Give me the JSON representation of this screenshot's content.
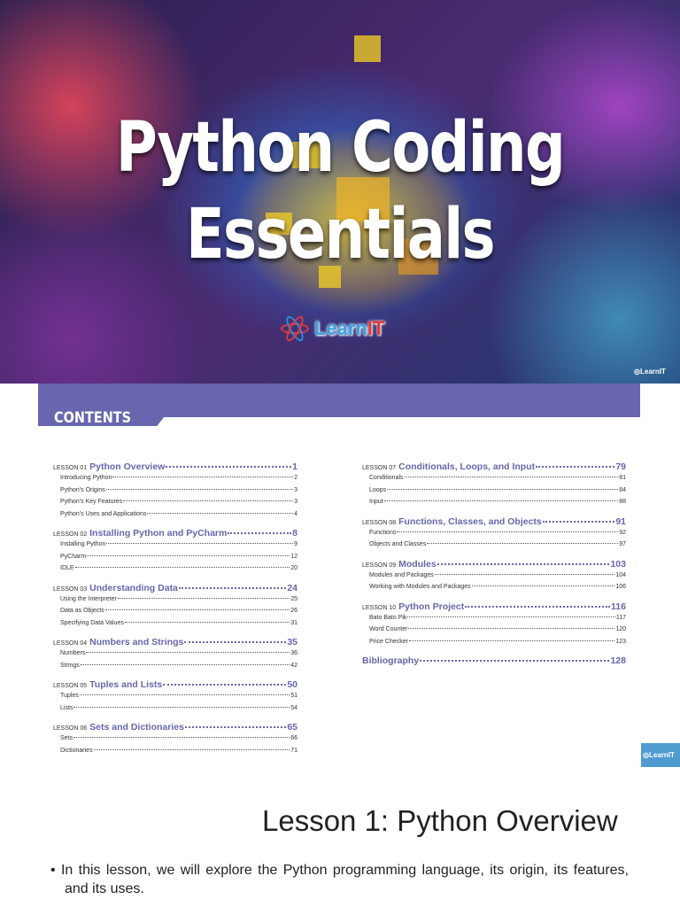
{
  "cover": {
    "title_line1": "Python Coding",
    "title_line2": "Essentials",
    "logo_text": "LearnIT"
  },
  "contents_label": "CONTENTS",
  "lesson_prefix": "LESSON",
  "toc_left": [
    {
      "num": "01",
      "title": "Python Overview",
      "page": "1",
      "subs": [
        [
          "Introducing Python",
          "2"
        ],
        [
          "Python's Origins",
          "3"
        ],
        [
          "Python's Key Features",
          "3"
        ],
        [
          "Python's Uses and Applications",
          "4"
        ]
      ]
    },
    {
      "num": "02",
      "title": "Installing Python and PyCharm",
      "page": "8",
      "subs": [
        [
          "Installing Python",
          "9"
        ],
        [
          "PyCharm",
          "12"
        ],
        [
          "IDLE",
          "20"
        ]
      ]
    },
    {
      "num": "03",
      "title": "Understanding Data",
      "page": "24",
      "subs": [
        [
          "Using the Interpreter",
          "25"
        ],
        [
          "Data as Objects",
          "26"
        ],
        [
          "Specifying Data Values",
          "31"
        ]
      ]
    },
    {
      "num": "04",
      "title": "Numbers and Strings",
      "page": "35",
      "subs": [
        [
          "Numbers",
          "36"
        ],
        [
          "Strings",
          "42"
        ]
      ]
    },
    {
      "num": "05",
      "title": "Tuples and Lists",
      "page": "50",
      "subs": [
        [
          "Tuples",
          "51"
        ],
        [
          "Lists",
          "54"
        ]
      ]
    },
    {
      "num": "06",
      "title": "Sets and Dictionaries",
      "page": "65",
      "subs": [
        [
          "Sets",
          "66"
        ],
        [
          "Dictionaries",
          "71"
        ]
      ]
    }
  ],
  "toc_right": [
    {
      "num": "07",
      "title": "Conditionals, Loops, and Input",
      "page": "79",
      "subs": [
        [
          "Conditionals",
          "81"
        ],
        [
          "Loops",
          "84"
        ],
        [
          "Input",
          "88"
        ]
      ]
    },
    {
      "num": "08",
      "title": "Functions, Classes, and Objects",
      "page": "91",
      "subs": [
        [
          "Functions",
          "92"
        ],
        [
          "Objects and Classes",
          "97"
        ]
      ]
    },
    {
      "num": "09",
      "title": "Modules",
      "page": "103",
      "subs": [
        [
          "Modules and Packages",
          "104"
        ],
        [
          "Working with Modules and Packages",
          "106"
        ]
      ]
    },
    {
      "num": "10",
      "title": "Python Project",
      "page": "116",
      "subs": [
        [
          "Bato Bato Pik",
          "117"
        ],
        [
          "Word Counter",
          "120"
        ],
        [
          "Price Checker",
          "123"
        ]
      ]
    },
    {
      "num": "",
      "title": "Bibliography",
      "page": "128",
      "subs": []
    }
  ],
  "slide": {
    "title": "Lesson 1: Python Overview",
    "bullets": [
      "In this lesson, we will explore the Python programming language, its origin, its features, and its uses."
    ]
  },
  "colors": {
    "accent": "#6766ae",
    "side_tab": "#4f9bd0"
  }
}
